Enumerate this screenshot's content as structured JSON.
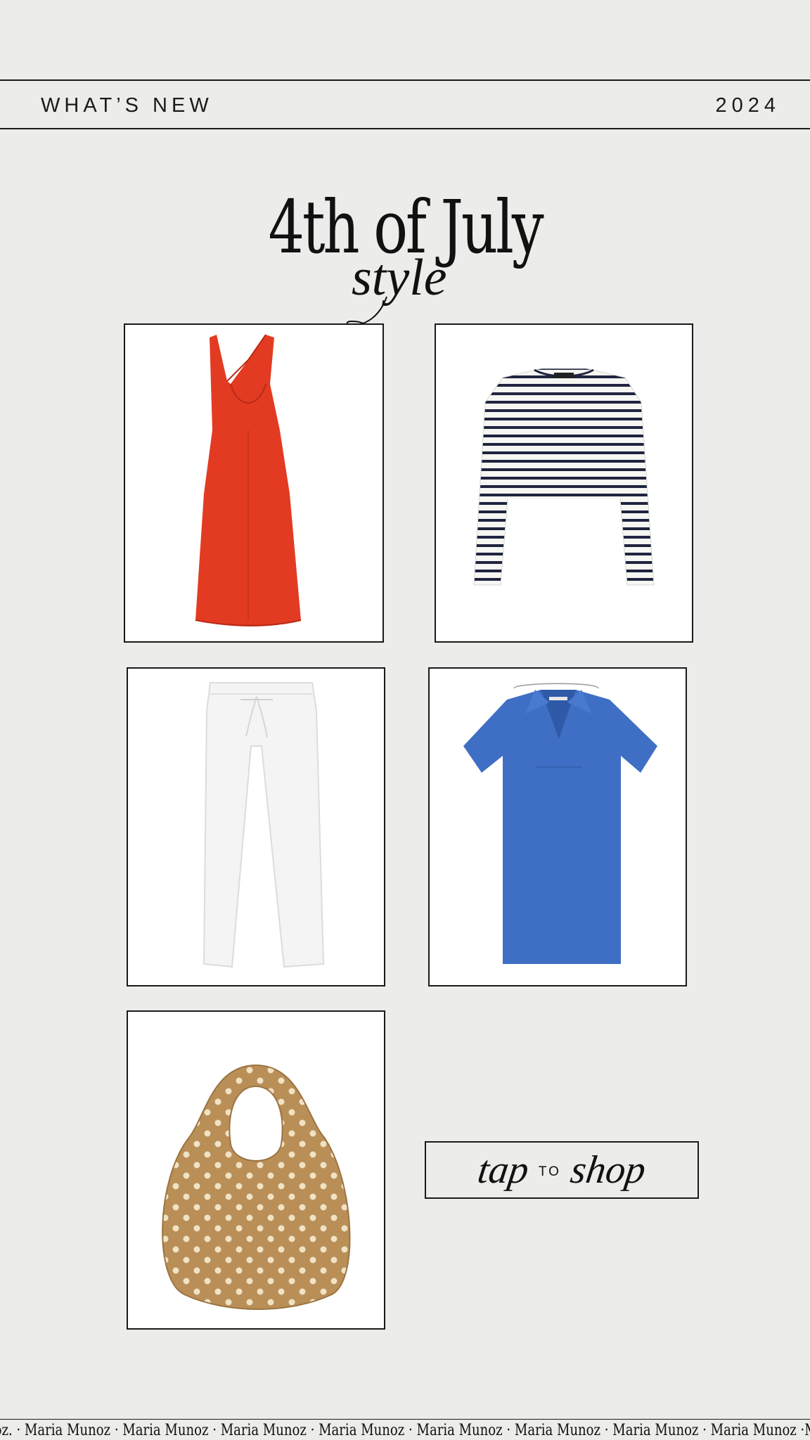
{
  "header": {
    "left_label": "WHAT’S NEW",
    "right_label": "2024"
  },
  "hero": {
    "title": "4th of July",
    "subtitle": "style"
  },
  "products": [
    {
      "name": "red-tank-dress",
      "color": "#e23b22"
    },
    {
      "name": "striped-long-sleeve-crop-top",
      "color": "#1f2440"
    },
    {
      "name": "white-linen-pants",
      "color": "#f3f3f3"
    },
    {
      "name": "blue-polo-dress",
      "color": "#3f6fc4"
    },
    {
      "name": "beaded-straw-bag",
      "color": "#b98f57"
    }
  ],
  "cta": {
    "word1": "tap",
    "word2": "TO",
    "word3": "shop"
  },
  "footer": {
    "ticker_text": "noz. · Maria Munoz · Maria Munoz · Maria Munoz · Maria Munoz · Maria Munoz · Maria Munoz · Maria Munoz · Maria Munoz ·Maria Munoz"
  },
  "colors": {
    "background": "#ececea",
    "border": "#1a1a1a",
    "card": "#ffffff"
  }
}
